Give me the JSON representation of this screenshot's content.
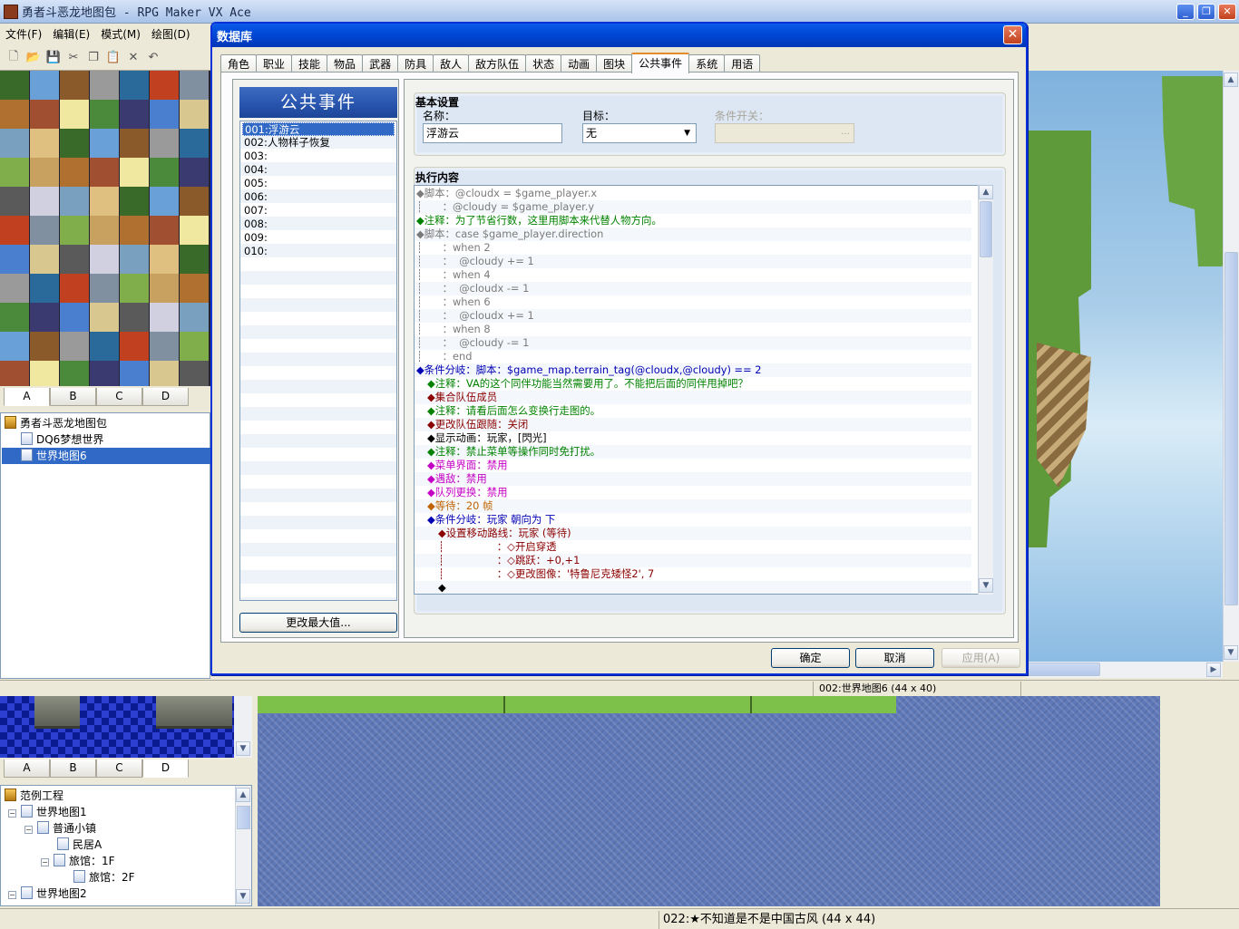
{
  "app": {
    "title": "勇者斗恶龙地图包 - RPG Maker VX Ace",
    "menu": [
      "文件(F)",
      "编辑(E)",
      "模式(M)",
      "绘图(D)"
    ]
  },
  "palette": {
    "tabs": [
      "A",
      "B",
      "C",
      "D"
    ],
    "selected": "A"
  },
  "upper_tree": {
    "items": [
      "勇者斗恶龙地图包",
      "DQ6梦想世界",
      "世界地图6"
    ]
  },
  "status_mid": "002:世界地图6 (44 x 40)",
  "lower_palette": {
    "tabs": [
      "A",
      "B",
      "C",
      "D"
    ],
    "selected": "D"
  },
  "lower_tree": {
    "items": [
      "范例工程",
      "世界地图1",
      "普通小镇",
      "民居A",
      "旅馆：1F",
      "旅馆：2F",
      "世界地图2"
    ]
  },
  "status_bottom": "022:★不知道是不是中国古风 (44 x 44)",
  "dialog": {
    "title": "数据库",
    "tabs": [
      "角色",
      "职业",
      "技能",
      "物品",
      "武器",
      "防具",
      "敌人",
      "敌方队伍",
      "状态",
      "动画",
      "图块",
      "公共事件",
      "系统",
      "用语"
    ],
    "active_tab": "公共事件",
    "banner": "公共事件",
    "events": [
      "001:浮游云",
      "002:人物样子恢复",
      "003:",
      "004:",
      "005:",
      "006:",
      "007:",
      "008:",
      "009:",
      "010:"
    ],
    "change_max": "更改最大值...",
    "basic_title": "基本设置",
    "name_label": "名称：",
    "name_value": "浮游云",
    "target_label": "目标：",
    "target_value": "无",
    "switch_label": "条件开关：",
    "switch_btn": "...",
    "exec_title": "执行内容",
    "code": [
      {
        "t": "◆脚本：@cloudx = $game_player.x",
        "c": "gray",
        "i": 0
      },
      {
        "t": "┊      ：@cloudy = $game_player.y",
        "c": "gray",
        "i": 0
      },
      {
        "t": "◆注释：为了节省行数，这里用脚本来代替人物方向。",
        "c": "green",
        "i": 0
      },
      {
        "t": "◆脚本：case $game_player.direction",
        "c": "gray",
        "i": 0
      },
      {
        "t": "┊      ：when 2",
        "c": "gray",
        "i": 0
      },
      {
        "t": "┊      ：  @cloudy += 1",
        "c": "gray",
        "i": 0
      },
      {
        "t": "┊      ：when 4",
        "c": "gray",
        "i": 0
      },
      {
        "t": "┊      ：  @cloudx -= 1",
        "c": "gray",
        "i": 0
      },
      {
        "t": "┊      ：when 6",
        "c": "gray",
        "i": 0
      },
      {
        "t": "┊      ：  @cloudx += 1",
        "c": "gray",
        "i": 0
      },
      {
        "t": "┊      ：when 8",
        "c": "gray",
        "i": 0
      },
      {
        "t": "┊      ：  @cloudy -= 1",
        "c": "gray",
        "i": 0
      },
      {
        "t": "┊      ：end",
        "c": "gray",
        "i": 0
      },
      {
        "t": "◆条件分岐：脚本：$game_map.terrain_tag(@cloudx,@cloudy) == 2",
        "c": "blue",
        "i": 0
      },
      {
        "t": "◆注释：VA的这个同伴功能当然需要用了。不能把后面的同伴甩掉吧？",
        "c": "green",
        "i": 1
      },
      {
        "t": "◆集合队伍成员",
        "c": "red",
        "i": 1
      },
      {
        "t": "◆注释：请看后面怎么变换行走图的。",
        "c": "green",
        "i": 1
      },
      {
        "t": "◆更改队伍跟随：关闭",
        "c": "red",
        "i": 1
      },
      {
        "t": "◆显示动画：玩家，[閃光]",
        "c": "dark",
        "i": 1
      },
      {
        "t": "◆注释：禁止菜单等操作同时免打扰。",
        "c": "green",
        "i": 1
      },
      {
        "t": "◆菜单界面：禁用",
        "c": "magenta",
        "i": 1
      },
      {
        "t": "◆遇敌：禁用",
        "c": "magenta",
        "i": 1
      },
      {
        "t": "◆队列更换：禁用",
        "c": "magenta",
        "i": 1
      },
      {
        "t": "◆等待：20 帧",
        "c": "orange",
        "i": 1
      },
      {
        "t": "◆条件分岐：玩家 朝向为 下",
        "c": "blue",
        "i": 1
      },
      {
        "t": "◆设置移动路线：玩家 (等待)",
        "c": "red",
        "i": 2
      },
      {
        "t": "┊                ：◇开启穿透",
        "c": "red",
        "i": 2
      },
      {
        "t": "┊                ：◇跳跃：+0,+1",
        "c": "red",
        "i": 2
      },
      {
        "t": "┊                ：◇更改图像：'特鲁尼克矮怪2', 7",
        "c": "red",
        "i": 2
      },
      {
        "t": "◆",
        "c": "dark",
        "i": 2
      }
    ],
    "ok": "确定",
    "cancel": "取消",
    "apply": "应用(A)"
  },
  "colors": {
    "accent": "#0831d9",
    "selection": "#3169c6",
    "tab_highlight": "#e68b2c"
  }
}
